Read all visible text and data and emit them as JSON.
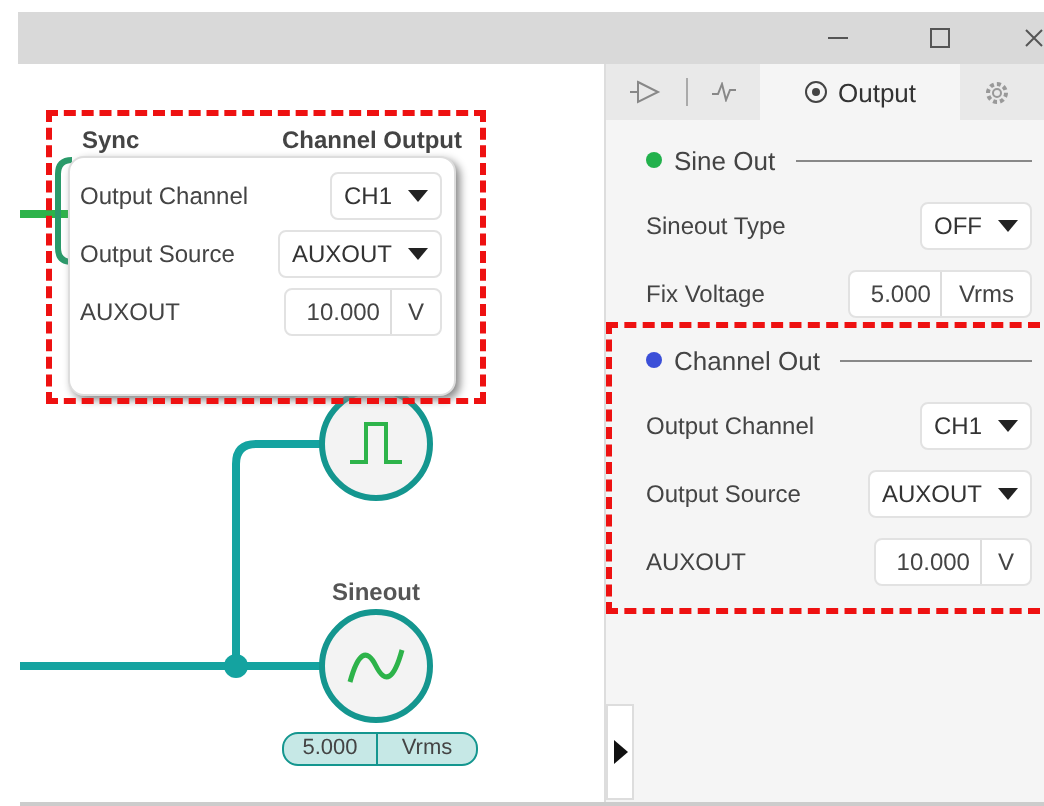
{
  "canvas": {
    "popup": {
      "titles": [
        "Sync",
        "Channel Output"
      ],
      "rows": [
        {
          "kind": "select",
          "label": "Output Channel",
          "value": "CH1"
        },
        {
          "kind": "select",
          "label": "Output Source",
          "value": "AUXOUT"
        },
        {
          "kind": "number",
          "label": "AUXOUT",
          "value": "10.000",
          "unit": "V"
        }
      ]
    },
    "sineout": {
      "label": "Sineout",
      "value": "5.000",
      "unit": "Vrms"
    }
  },
  "tabs": [
    {
      "selected": false
    },
    {
      "selected": false
    },
    {
      "label": "Output",
      "selected": true
    },
    {
      "selected": false
    }
  ],
  "sections": [
    {
      "title": "Sine Out",
      "color": "#22b14c",
      "rows": [
        {
          "kind": "select",
          "label": "Sineout Type",
          "value": "OFF"
        },
        {
          "kind": "number",
          "label": "Fix Voltage",
          "value": "5.000",
          "unit": "Vrms"
        }
      ]
    },
    {
      "title": "Channel Out",
      "color": "#3b4fd8",
      "rows": [
        {
          "kind": "select",
          "label": "Output Channel",
          "value": "CH1"
        },
        {
          "kind": "select",
          "label": "Output Source",
          "value": "AUXOUT"
        },
        {
          "kind": "number",
          "label": "AUXOUT",
          "value": "10.000",
          "unit": "V"
        }
      ]
    }
  ]
}
